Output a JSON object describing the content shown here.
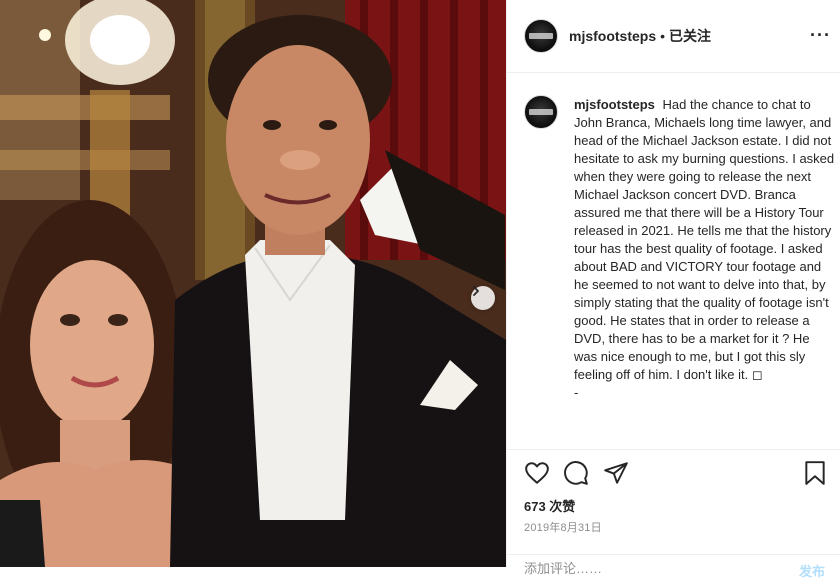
{
  "post": {
    "username": "mjsfootsteps",
    "separator": "•",
    "follow_status": "已关注",
    "more_label": "···",
    "caption": "Had the chance to chat to John Branca, Michaels long time lawyer, and head of the Michael Jackson estate. I did not hesitate to ask my burning questions. I asked when they were going to release the next Michael Jackson concert DVD. Branca assured me that there will be a History Tour released in 2021. He tells me that the history tour has the best quality of footage. I asked about BAD and VICTORY tour footage and he seemed to not want to delve into that, by simply stating that the quality of footage isn't good. He states that in order to release a DVD, there has to be a market for it ? He was nice enough to me, but I got this sly feeling off of him. I don't like it. ◻",
    "caption_trailing": "-",
    "likes": "673 次赞",
    "date": "2019年8月31日",
    "comment_placeholder": "添加评论……",
    "post_button": "发布"
  },
  "icons": {
    "like": "heart-icon",
    "comment": "comment-icon",
    "share": "paper-plane-icon",
    "save": "bookmark-icon",
    "next": "chevron-right-icon"
  },
  "colors": {
    "text": "#262626",
    "secondary": "#8e8e8e",
    "border": "#efefef",
    "post_disabled": "#b2dffc"
  }
}
